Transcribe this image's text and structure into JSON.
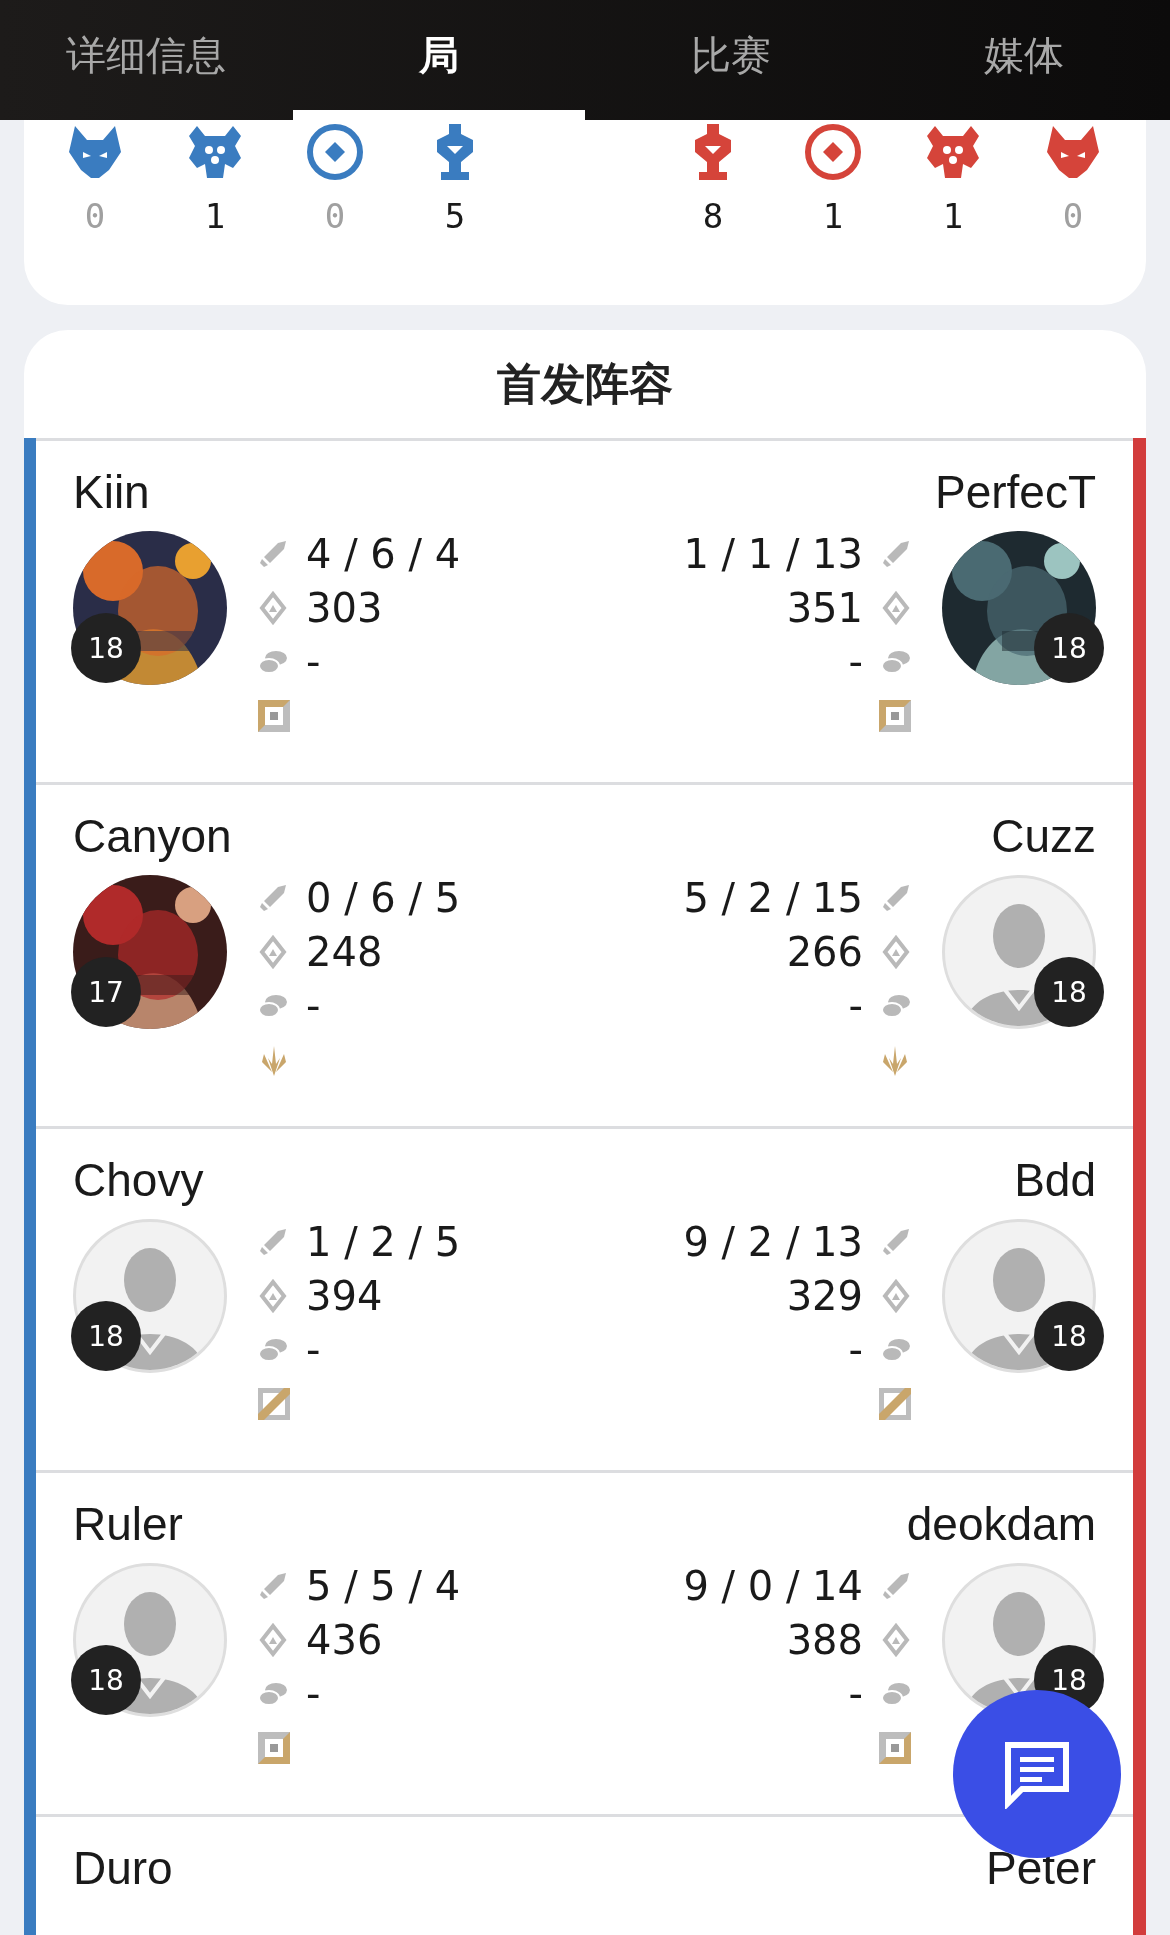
{
  "tabs": [
    {
      "label": "详细信息",
      "selected": false
    },
    {
      "label": "局",
      "selected": true
    },
    {
      "label": "比赛",
      "selected": false
    },
    {
      "label": "媒体",
      "selected": false
    }
  ],
  "objectives": {
    "blue": [
      {
        "kind": "beast",
        "count": "0",
        "dim": true
      },
      {
        "kind": "spider",
        "count": "1",
        "dim": false
      },
      {
        "kind": "target",
        "count": "0",
        "dim": true
      },
      {
        "kind": "tower",
        "count": "5",
        "dim": false
      }
    ],
    "red": [
      {
        "kind": "tower",
        "count": "8",
        "dim": false
      },
      {
        "kind": "target",
        "count": "1",
        "dim": false
      },
      {
        "kind": "spider",
        "count": "1",
        "dim": false
      },
      {
        "kind": "beast",
        "count": "0",
        "dim": true
      }
    ]
  },
  "lineup": {
    "title": "首发阵容",
    "rows": [
      {
        "blue": {
          "name": "Kiin",
          "level": "18",
          "kda": "4 / 6 / 4",
          "cs": "303",
          "gold": "-",
          "role": {
            "kind": "square"
          }
        },
        "red": {
          "name": "PerfecT",
          "level": "18",
          "kda": "1 / 1 / 13",
          "cs": "351",
          "gold": "-",
          "role": {
            "kind": "square"
          }
        }
      },
      {
        "blue": {
          "name": "Canyon",
          "level": "17",
          "kda": "0 / 6 / 5",
          "cs": "248",
          "gold": "-",
          "role": {
            "kind": "claws"
          }
        },
        "red": {
          "name": "Cuzz",
          "level": "18",
          "avatar": {
            "kind": "default"
          },
          "kda": "5 / 2 / 15",
          "cs": "266",
          "gold": "-",
          "role": {
            "kind": "claws"
          }
        }
      },
      {
        "blue": {
          "name": "Chovy",
          "level": "18",
          "avatar": {
            "kind": "default"
          },
          "kda": "1 / 2 / 5",
          "cs": "394",
          "gold": "-",
          "role": {
            "kind": "slash"
          }
        },
        "red": {
          "name": "Bdd",
          "level": "18",
          "avatar": {
            "kind": "default"
          },
          "kda": "9 / 2 / 13",
          "cs": "329",
          "gold": "-",
          "role": {
            "kind": "slash"
          }
        }
      },
      {
        "blue": {
          "name": "Ruler",
          "level": "18",
          "avatar": {
            "kind": "default"
          },
          "kda": "5 / 5 / 4",
          "cs": "436",
          "gold": "-",
          "role": {
            "kind": "corner"
          }
        },
        "red": {
          "name": "deokdam",
          "level": "18",
          "avatar": {
            "kind": "default"
          },
          "kda": "9 / 0 / 14",
          "cs": "388",
          "gold": "-",
          "role": {
            "kind": "corner"
          }
        }
      },
      {
        "blue": {
          "name": "Duro"
        },
        "red": {
          "name": "Peter"
        }
      }
    ]
  }
}
